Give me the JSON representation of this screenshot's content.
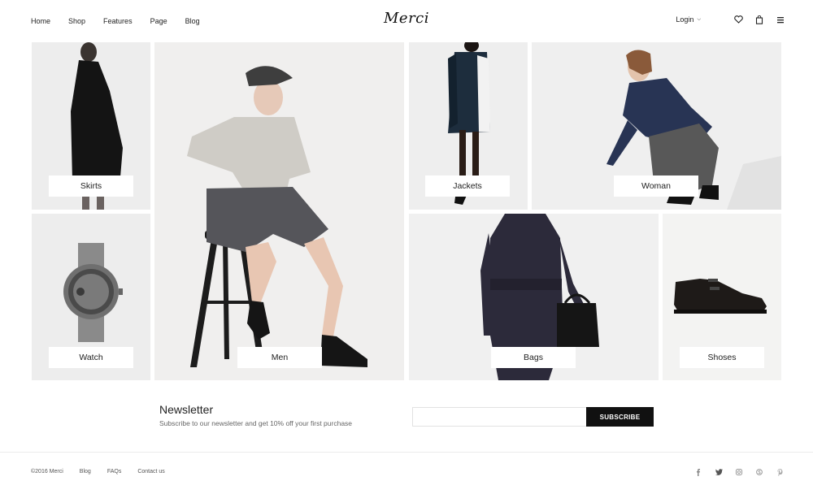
{
  "header": {
    "nav": [
      "Home",
      "Shop",
      "Features",
      "Page",
      "Blog"
    ],
    "logo": "Merci",
    "login_label": "Login",
    "icons": [
      "heart-icon",
      "shopping-bag-icon",
      "hamburger-menu-icon"
    ]
  },
  "tiles": {
    "skirts": "Skirts",
    "men": "Men",
    "jackets": "Jackets",
    "woman": "Woman",
    "watch": "Watch",
    "bags": "Bags",
    "shoes": "Shoses"
  },
  "newsletter": {
    "title": "Newsletter",
    "subtitle": "Subscribe to our newsletter and get 10% off your first purchase",
    "input_value": "",
    "button_label": "SUBSCRIBE"
  },
  "footer": {
    "copyright": "©2016 Merci",
    "links": [
      "Blog",
      "FAQs",
      "Contact us"
    ],
    "socials": [
      "facebook-icon",
      "twitter-icon",
      "instagram-icon",
      "skype-icon",
      "pinterest-icon"
    ]
  },
  "colors": {
    "accent": "#111111",
    "tile_bg": "#ececec",
    "footer_text": "#555555"
  }
}
